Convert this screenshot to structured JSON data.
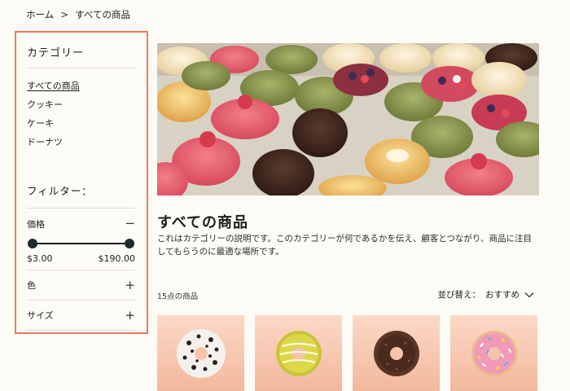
{
  "breadcrumb": {
    "home": "ホーム",
    "separator": ">",
    "current": "すべての商品"
  },
  "sidebar": {
    "category_title": "カテゴリー",
    "categories": [
      {
        "label": "すべての商品",
        "active": true
      },
      {
        "label": "クッキー"
      },
      {
        "label": "ケーキ"
      },
      {
        "label": "ドーナツ"
      }
    ],
    "filter_title": "フィルター：",
    "price": {
      "label": "価格",
      "toggle": "−",
      "min": "$3.00",
      "max": "$190.00"
    },
    "color": {
      "label": "色",
      "toggle": "+"
    },
    "size": {
      "label": "サイズ",
      "toggle": "+"
    }
  },
  "main": {
    "title": "すべての商品",
    "description": "これはカテゴリーの説明です。このカテゴリーが何であるかを伝え、顧客とつながり、商品に注目してもらうのに最適な場所です。",
    "count": "15点の商品",
    "sort_label": "並び替え：",
    "sort_value": "おすすめ"
  },
  "products": [
    {
      "icon": "donut-cookies-cream-icon"
    },
    {
      "icon": "donut-yellow-glaze-icon"
    },
    {
      "icon": "donut-chocolate-icon"
    },
    {
      "icon": "donut-pink-sprinkles-icon"
    }
  ],
  "colors": {
    "accent_border": "#ef7a5c",
    "background": "#fdfbf5",
    "card_bg": "#f6c4ab"
  }
}
